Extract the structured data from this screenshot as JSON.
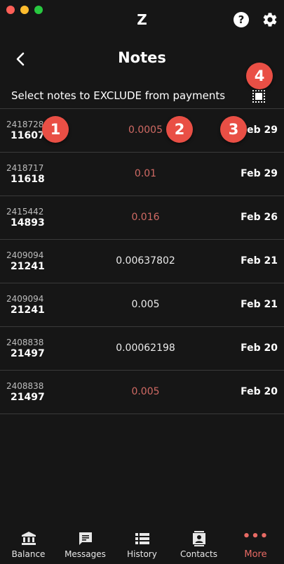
{
  "app": {
    "logo": "Z",
    "help_glyph": "?"
  },
  "header": {
    "title": "Notes"
  },
  "subtitle": "Select notes to EXCLUDE from payments",
  "badges": [
    "1",
    "2",
    "3",
    "4"
  ],
  "notes": [
    {
      "id1": "2418728",
      "id2": "11607",
      "amount": "0.0005",
      "date": "Feb 29"
    },
    {
      "id1": "2418717",
      "id2": "11618",
      "amount": "0.01",
      "date": "Feb 29"
    },
    {
      "id1": "2415442",
      "id2": "14893",
      "amount": "0.016",
      "date": "Feb 26"
    },
    {
      "id1": "2409094",
      "id2": "21241",
      "amount": "0.00637802",
      "date": "Feb 21"
    },
    {
      "id1": "2409094",
      "id2": "21241",
      "amount": "0.005",
      "date": "Feb 21"
    },
    {
      "id1": "2408838",
      "id2": "21497",
      "amount": "0.00062198",
      "date": "Feb 20"
    },
    {
      "id1": "2408838",
      "id2": "21497",
      "amount": "0.005",
      "date": "Feb 20"
    }
  ],
  "tabs": [
    {
      "label": "Balance",
      "icon": "bank-icon"
    },
    {
      "label": "Messages",
      "icon": "message-icon"
    },
    {
      "label": "History",
      "icon": "history-icon"
    },
    {
      "label": "Contacts",
      "icon": "contacts-icon"
    },
    {
      "label": "More",
      "icon": "more-icon",
      "glyph": "•••"
    }
  ],
  "colors": {
    "accent": "#e86a64",
    "badge": "#e94f45",
    "excluded_amount": "#d06a64",
    "background": "#161616"
  }
}
